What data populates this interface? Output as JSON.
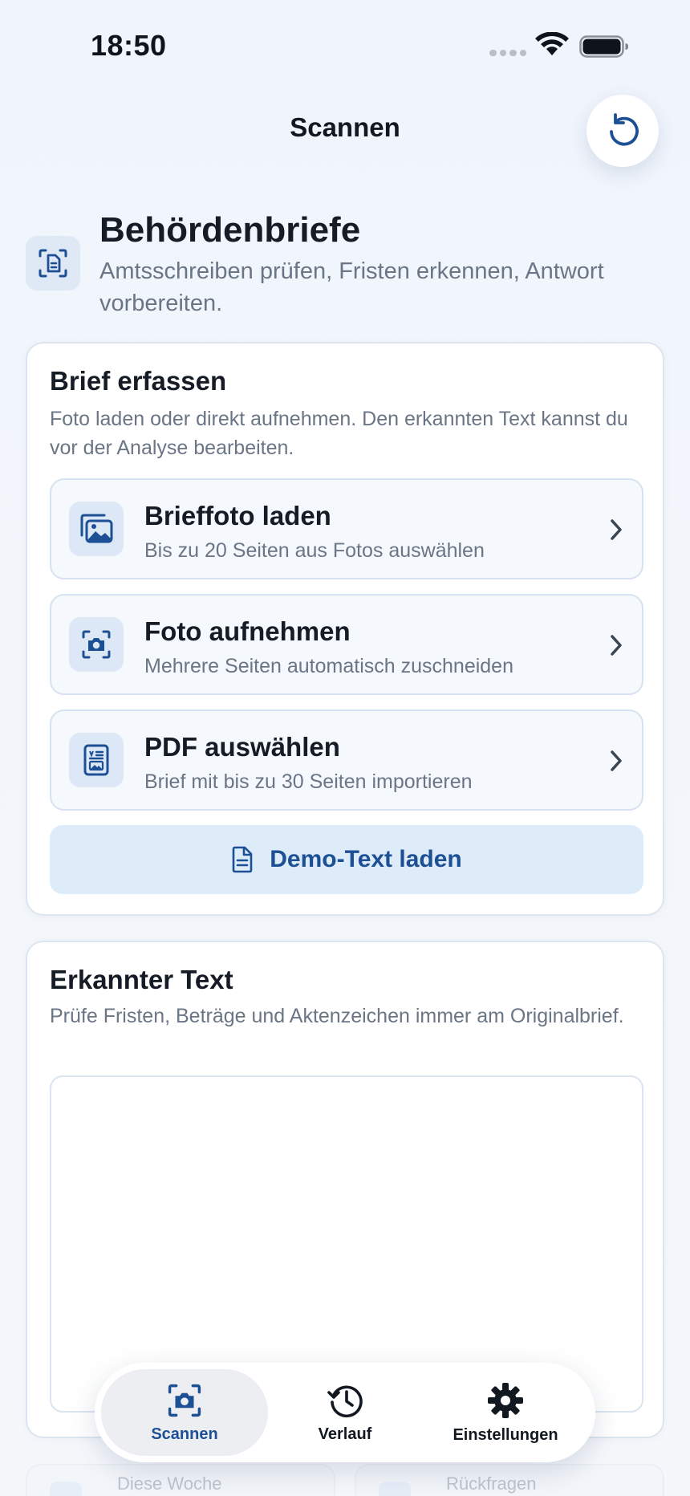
{
  "status_bar": {
    "time": "18:50"
  },
  "nav": {
    "title": "Scannen",
    "reset_icon": "rotate-ccw-icon"
  },
  "header": {
    "icon": "document-scan-icon",
    "title": "Behördenbriefe",
    "subtitle": "Amtsschreiben prüfen, Fristen erkennen, Antwort vorbereiten."
  },
  "capture": {
    "title": "Brief erfassen",
    "description": "Foto laden oder direkt aufnehmen. Den erkannten Text kannst du vor der Analyse bearbeiten.",
    "options": [
      {
        "icon": "photos-icon",
        "title": "Brieffoto laden",
        "subtitle": "Bis zu 20 Seiten aus Fotos auswählen"
      },
      {
        "icon": "camera-viewfinder-icon",
        "title": "Foto aufnehmen",
        "subtitle": "Mehrere Seiten automatisch zuschneiden"
      },
      {
        "icon": "pdf-document-icon",
        "title": "PDF auswählen",
        "subtitle": "Brief mit bis zu 30 Seiten importieren"
      }
    ],
    "demo_button": "Demo-Text laden"
  },
  "recognized": {
    "title": "Erkannter Text",
    "description": "Prüfe Fristen, Beträge und Aktenzeichen immer am Originalbrief.",
    "text_value": ""
  },
  "tabs": [
    {
      "icon": "camera-viewfinder-icon",
      "label": "Scannen",
      "active": true
    },
    {
      "icon": "clock-history-icon",
      "label": "Verlauf",
      "active": false
    },
    {
      "icon": "gear-icon",
      "label": "Einstellungen",
      "active": false
    }
  ],
  "peek": [
    "Diese Woche",
    "Rückfragen"
  ],
  "colors": {
    "accent": "#1d4f95",
    "background": "#f0f5fc",
    "muted_text": "#6a7585"
  }
}
